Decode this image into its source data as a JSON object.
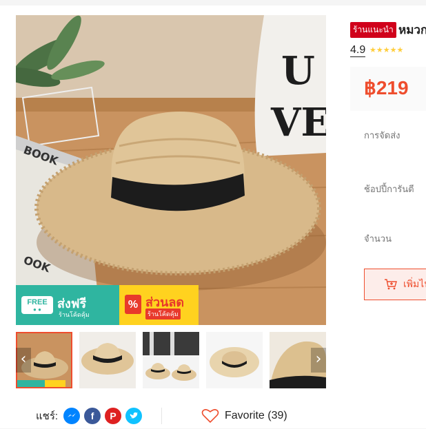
{
  "product": {
    "mall_badge": "ร้านแนะนำ",
    "title": "หมวก",
    "rating": "4.9",
    "stars": "★★★★★",
    "price": "฿219"
  },
  "labels": {
    "shipping": "การจัดส่ง",
    "guarantee": "ช้อปปี้การันตี",
    "quantity": "จำนวน",
    "add_to_cart": "เพิ่มไป"
  },
  "promo": {
    "free_badge": "FREE",
    "free_title": "ส่งฟรี",
    "free_sub": "ร้านโค้ดคุ้ม",
    "sale_icon": "%",
    "sale_title": "ส่วนลด",
    "sale_sub": "ร้านโค้ดคุ้ม"
  },
  "gallery": {
    "prev_icon": "‹",
    "next_icon": "›"
  },
  "share": {
    "label": "แชร์:",
    "icons": [
      "messenger-icon",
      "facebook-icon",
      "pinterest-icon",
      "twitter-icon"
    ]
  },
  "favorite": {
    "label": "Favorite (39)"
  },
  "colors": {
    "accent": "#ee4d2d",
    "mall_badge_bg": "#d0011b",
    "star": "#ffce3d"
  }
}
